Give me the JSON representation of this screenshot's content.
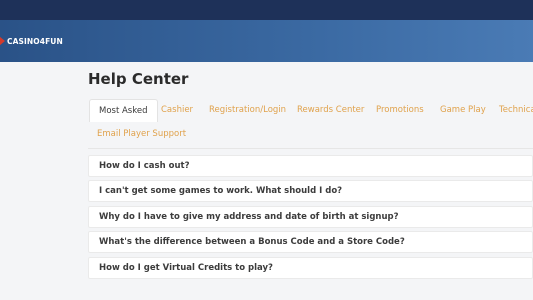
{
  "brand": {
    "name": "CASINO4FUN"
  },
  "page": {
    "title": "Help Center"
  },
  "tabs": [
    {
      "label": "Most Asked",
      "active": true
    },
    {
      "label": "Cashier",
      "active": false
    },
    {
      "label": "Registration/Login",
      "active": false
    },
    {
      "label": "Rewards Center",
      "active": false
    },
    {
      "label": "Promotions",
      "active": false
    },
    {
      "label": "Game Play",
      "active": false
    },
    {
      "label": "Technica",
      "active": false
    },
    {
      "label": "Email Player Support",
      "active": false
    }
  ],
  "faq": [
    {
      "question": "How do I cash out?"
    },
    {
      "question": "I can't get some games to work. What should I do?"
    },
    {
      "question": "Why do I have to give my address and date of birth at signup?"
    },
    {
      "question": "What's the difference between a Bonus Code and a Store Code?"
    },
    {
      "question": "How do I get Virtual Credits to play?"
    }
  ],
  "colors": {
    "topbar": "#1e3159",
    "header": "#2a5287",
    "tab_link": "#e0a24c",
    "logo_accent": "#d33a2c"
  }
}
